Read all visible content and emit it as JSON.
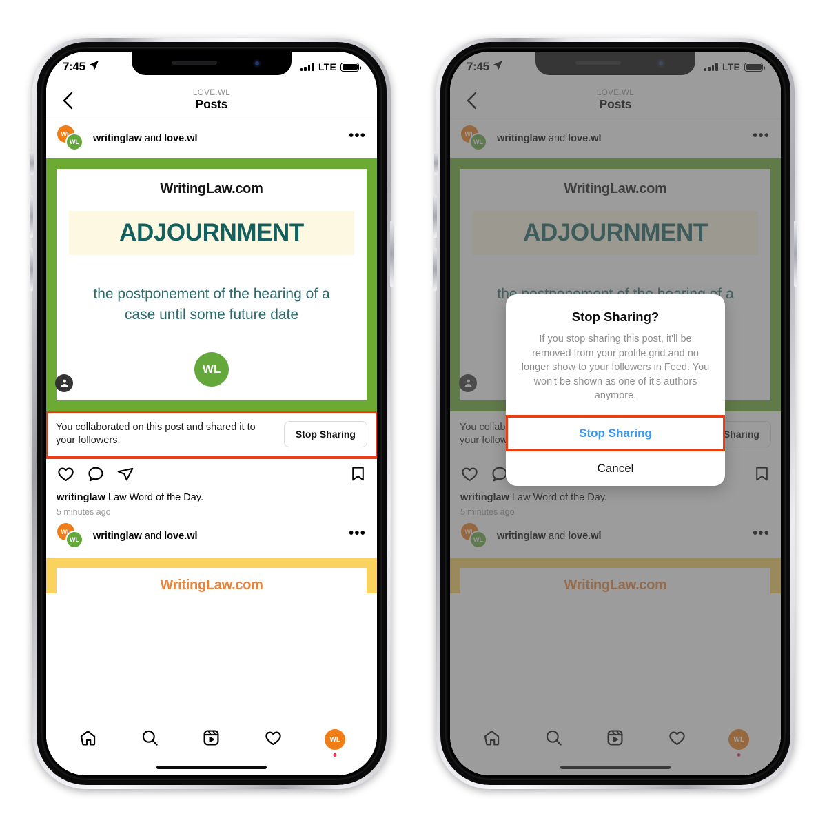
{
  "statusbar": {
    "time": "7:45",
    "location_icon": "location-arrow-icon",
    "signal_icon": "signal-bars-icon",
    "network": "LTE",
    "battery_icon": "battery-full-icon"
  },
  "navbar": {
    "back_icon": "back-chevron-icon",
    "subtitle": "LOVE.WL",
    "title": "Posts"
  },
  "post": {
    "avatar_primary_initials": "WL",
    "avatar_secondary_initials": "WL",
    "username": "writinglaw and love.wl",
    "username_bold": "writinglaw",
    "username_rest": " and ",
    "username_bold2": "love.wl",
    "more_icon": "more-options-icon",
    "card": {
      "brand": "WritingLaw.com",
      "word": "ADJOURNMENT",
      "definition": "the postponement of the hearing of a case until some future date",
      "logo_initials": "WL",
      "tag_icon": "person-tag-icon",
      "border_color": "#6DAA33",
      "band_color": "#FCF8E2",
      "word_color": "#13605E"
    },
    "collab": {
      "text": "You collaborated on this post and shared it to your followers.",
      "button_label": "Stop Sharing",
      "highlight_color": "#F03C10"
    },
    "actions": {
      "like_icon": "heart-icon",
      "comment_icon": "comment-bubble-icon",
      "share_icon": "share-paper-plane-icon",
      "save_icon": "bookmark-icon"
    },
    "caption_user": "writinglaw",
    "caption_text": " Law Word of the Day.",
    "timestamp": "5 minutes ago"
  },
  "post2": {
    "username_bold": "writinglaw",
    "username_rest": " and ",
    "username_bold2": "love.wl",
    "more_icon": "more-options-icon",
    "brand": "WritingLaw.com",
    "border_color": "#FAD35E",
    "brand_color": "#E8853C"
  },
  "tabbar": {
    "home_icon": "home-icon",
    "search_icon": "search-icon",
    "reels_icon": "reels-icon",
    "activity_icon": "heart-icon",
    "profile_initials": "WL",
    "profile_badge": "unread-dot"
  },
  "dialog": {
    "title": "Stop Sharing?",
    "message": "If you stop sharing this post, it'll be removed from your profile grid and no longer show to your followers in Feed. You won't be shown as one of it's authors anymore.",
    "primary_label": "Stop Sharing",
    "cancel_label": "Cancel",
    "primary_color": "#3897F0",
    "highlight_color": "#F03C10"
  }
}
